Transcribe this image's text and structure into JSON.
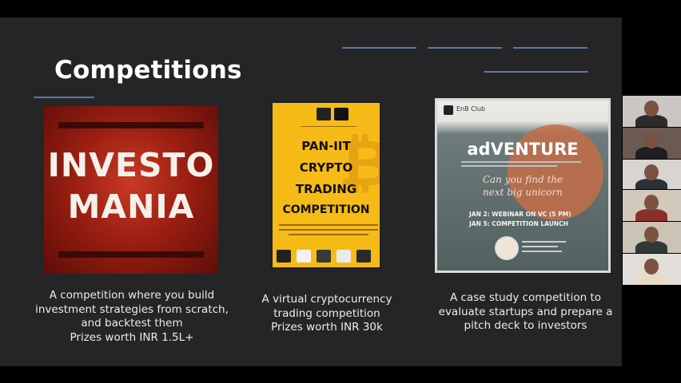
{
  "slide": {
    "title": "Competitions"
  },
  "competitions": [
    {
      "poster": {
        "line1": "INVESTO",
        "line2": "MANIA"
      },
      "description": [
        "A competition where you build",
        "investment strategies from scratch,",
        "and backtest them",
        "Prizes worth INR 1.5L+"
      ]
    },
    {
      "poster": {
        "title_lines": [
          "PAN-IIT",
          "CRYPTO",
          "TRADING",
          "COMPETITION"
        ]
      },
      "description": [
        "A virtual cryptocurrency",
        "trading competition",
        "Prizes worth INR 30k"
      ]
    },
    {
      "poster": {
        "club": "EnB Club",
        "heading": "adVENTURE",
        "script": [
          "Can you find the",
          "next big unicorn"
        ],
        "schedule": [
          "JAN 2: WEBINAR ON VC (5 PM)",
          "JAN 5: COMPETITION LAUNCH"
        ]
      },
      "description": [
        "A case study competition to",
        "evaluate startups and prepare a",
        "pitch deck to investors"
      ]
    }
  ],
  "participants": [
    {
      "bg": "#c9c6c3",
      "shirt": "#2b2b2b"
    },
    {
      "bg": "#6b5a52",
      "shirt": "#1f1f22"
    },
    {
      "bg": "#d8d4cf",
      "shirt": "#2c3138"
    },
    {
      "bg": "#d2c8bb",
      "shirt": "#8a2f2a"
    },
    {
      "bg": "#cbc3b6",
      "shirt": "#2f3a36"
    },
    {
      "bg": "#e2ded9",
      "shirt": "#e9d9c8"
    }
  ],
  "colors": {
    "slide_bg": "#252528",
    "accent_line": "#5d76a9",
    "title": "#ffffff"
  }
}
